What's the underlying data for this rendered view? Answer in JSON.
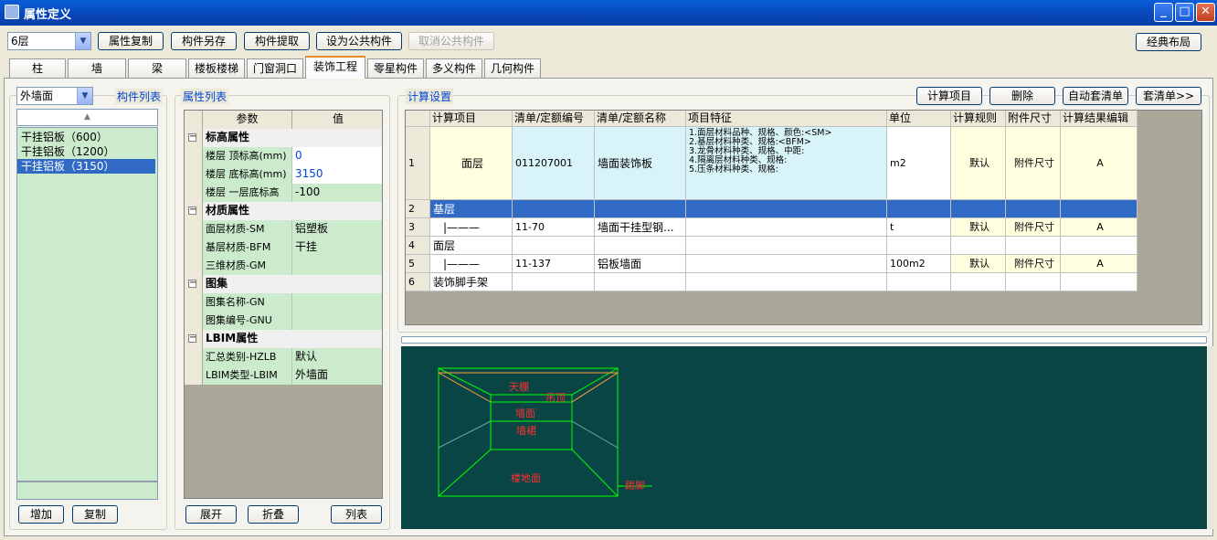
{
  "window": {
    "title": "属性定义",
    "min": "_",
    "max": "□",
    "close": "✕"
  },
  "toolbar": {
    "floor": "6层",
    "buttons": [
      "属性复制",
      "构件另存",
      "构件提取",
      "设为公共构件",
      "取消公共构件"
    ],
    "classic_layout": "经典布局"
  },
  "tabs": [
    "柱",
    "墙",
    "梁",
    "楼板楼梯",
    "门窗洞口",
    "装饰工程",
    "零星构件",
    "多义构件",
    "几何构件"
  ],
  "component_panel": {
    "type_value": "外墙面",
    "title": "构件列表",
    "scroll_up": "▲",
    "items": [
      "干挂铝板（600）",
      "干挂铝板（1200）",
      "干挂铝板（3150）"
    ],
    "add": "增加",
    "copy": "复制"
  },
  "attr_panel": {
    "title": "属性列表",
    "col_param": "参数",
    "col_value": "值",
    "rows": [
      {
        "group": true,
        "name": "标高属性",
        "value": ""
      },
      {
        "group": false,
        "name": "楼层 顶标高(mm)",
        "value": "0"
      },
      {
        "group": false,
        "name": "楼层 底标高(mm)",
        "value": "3150"
      },
      {
        "group": false,
        "name": "楼层 一层底标高",
        "value": "-100"
      },
      {
        "group": true,
        "name": "材质属性",
        "value": ""
      },
      {
        "group": false,
        "name": "面层材质-SM",
        "value": "铝塑板"
      },
      {
        "group": false,
        "name": "基层材质-BFM",
        "value": "干挂"
      },
      {
        "group": false,
        "name": "三维材质-GM",
        "value": ""
      },
      {
        "group": true,
        "name": "图集",
        "value": ""
      },
      {
        "group": false,
        "name": "图集名称-GN",
        "value": ""
      },
      {
        "group": false,
        "name": "图集编号-GNU",
        "value": ""
      },
      {
        "group": true,
        "name": "LBIM属性",
        "value": ""
      },
      {
        "group": false,
        "name": "汇总类别-HZLB",
        "value": "默认"
      },
      {
        "group": false,
        "name": "LBIM类型-LBIM",
        "value": "外墙面"
      }
    ],
    "expand": "展开",
    "collapse": "折叠",
    "list": "列表",
    "minus": "−"
  },
  "calc_panel": {
    "title": "计算设置",
    "buttons": [
      "计算项目",
      "删除",
      "自动套清单",
      "套清单>>"
    ],
    "headers": [
      "计算项目",
      "清单/定额编号",
      "清单/定额名称",
      "项目特征",
      "单位",
      "计算规则",
      "附件尺寸",
      "计算结果编辑"
    ],
    "rows": [
      {
        "n": "1",
        "item": "面层",
        "code": "011207001",
        "name": "墙面装饰板",
        "feature": [
          "1.面层材料品种、规格、颜色:<SM>",
          "2.基层材料种类、规格:<BFM>",
          "3.龙骨材料种类、规格、中距:",
          "4.隔离层材料种类、规格:",
          "5.压条材料种类、规格:"
        ],
        "unit": "m2",
        "rule": "默认",
        "size": "附件尺寸",
        "result": "A"
      },
      {
        "n": "2",
        "item": "基层",
        "code": "",
        "name": "",
        "feature": [],
        "unit": "",
        "rule": "",
        "size": "",
        "result": ""
      },
      {
        "n": "3",
        "item": "|———",
        "code": "11-70",
        "name": "墙面干挂型钢...",
        "feature": [],
        "unit": "t",
        "rule": "默认",
        "size": "附件尺寸",
        "result": "A"
      },
      {
        "n": "4",
        "item": "面层",
        "code": "",
        "name": "",
        "feature": [],
        "unit": "",
        "rule": "",
        "size": "",
        "result": ""
      },
      {
        "n": "5",
        "item": "|———",
        "code": "11-137",
        "name": "铝板墙面",
        "feature": [],
        "unit": "100m2",
        "rule": "默认",
        "size": "附件尺寸",
        "result": "A"
      },
      {
        "n": "6",
        "item": "装饰脚手架",
        "code": "",
        "name": "",
        "feature": [],
        "unit": "",
        "rule": "",
        "size": "",
        "result": ""
      }
    ]
  },
  "diagram": {
    "labels": {
      "ceiling": "天棚",
      "drop": "吊顶",
      "wall": "墙面",
      "dado": "墙裙",
      "floor": "楼地面",
      "skirting": "踢脚"
    },
    "colors": {
      "background": "#0a4545",
      "frame": "#00ff00",
      "label": "#ff3030",
      "ceiling_line": "#ffa040"
    }
  }
}
